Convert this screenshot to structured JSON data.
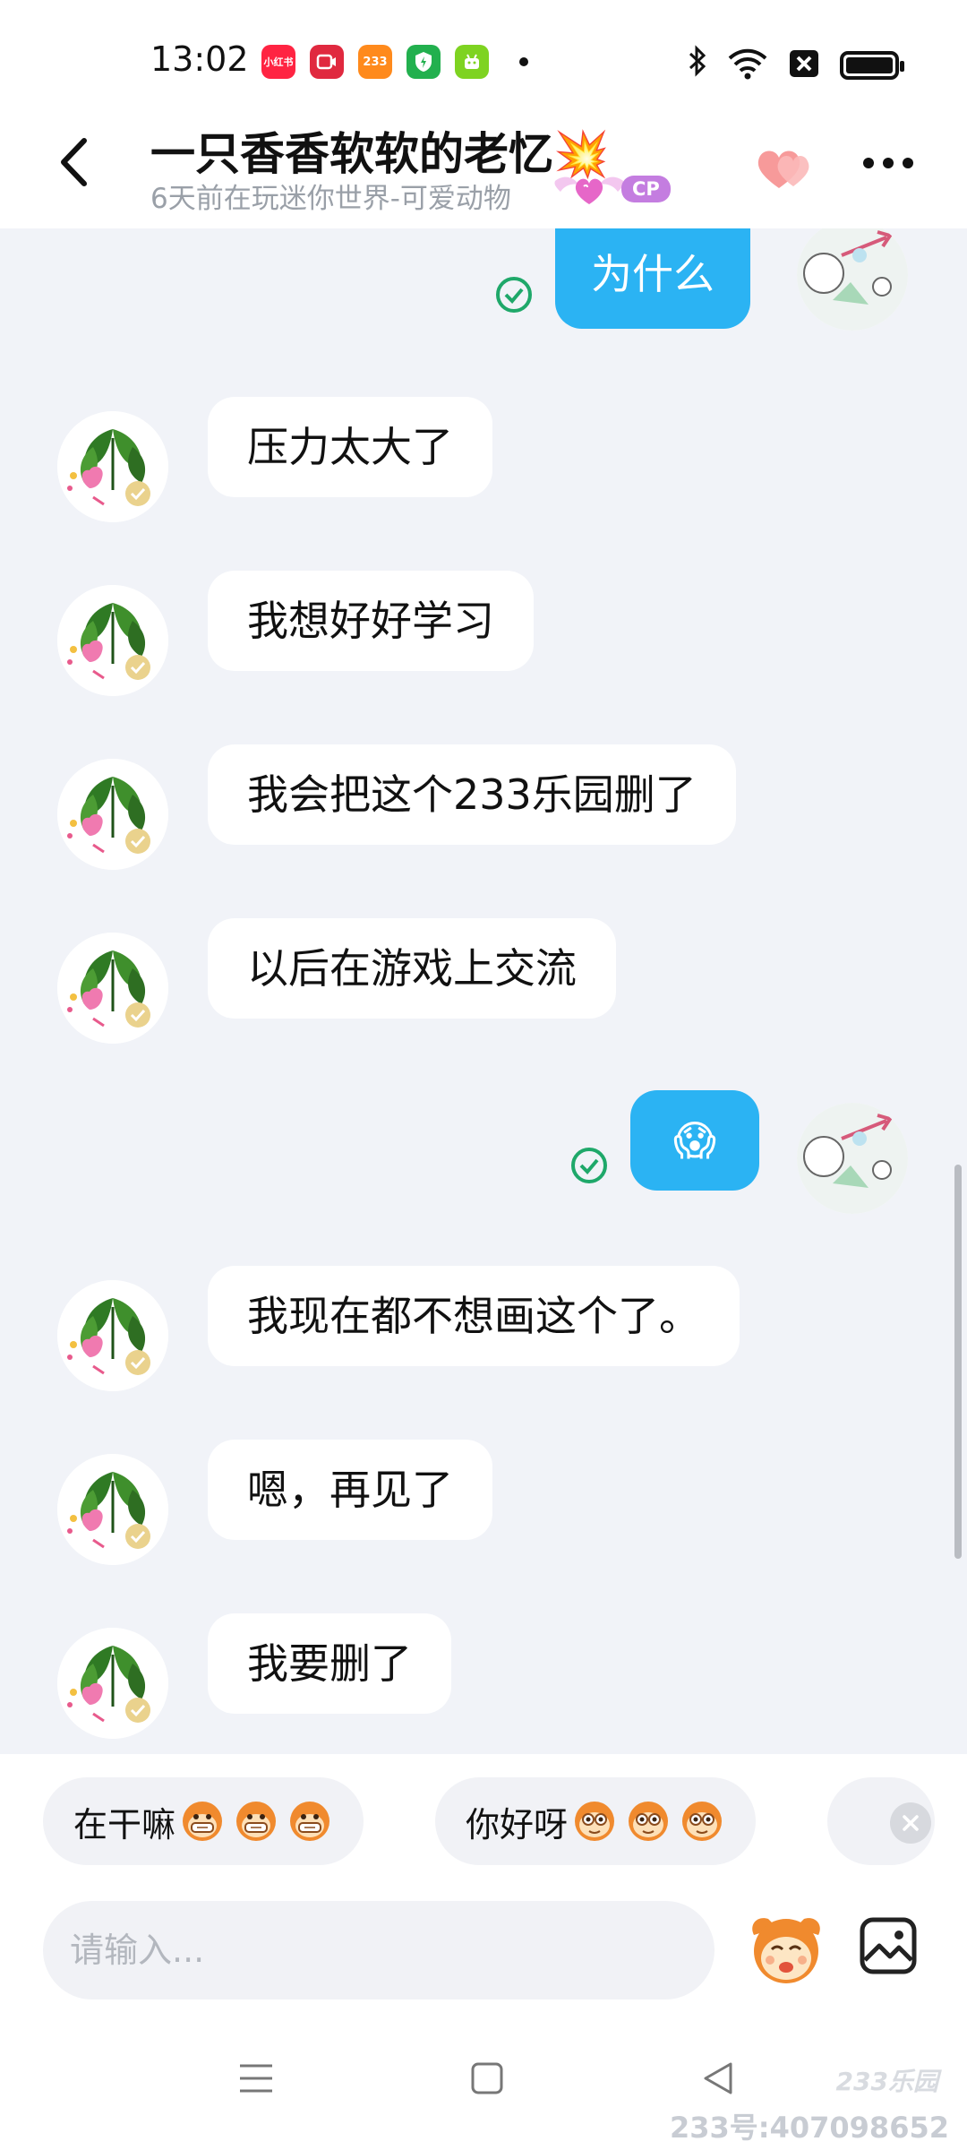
{
  "status_bar": {
    "time": "13:02",
    "apps": [
      {
        "name": "xiaohongshu-app-icon",
        "label": "小红书",
        "color": "#ff2442"
      },
      {
        "name": "video-app-icon",
        "label": "",
        "color": "#e0293f"
      },
      {
        "name": "233-app-icon",
        "label": "233",
        "color": "#ff8a1c"
      },
      {
        "name": "shield-app-icon",
        "label": "",
        "color": "#22b04e"
      },
      {
        "name": "android-app-icon",
        "label": "",
        "color": "#7ed321"
      }
    ]
  },
  "header": {
    "title": "一只香香软软的老忆💥",
    "subtitle": "6天前在玩迷你世界-可爱动物",
    "cp_badge": "CP"
  },
  "messages": [
    {
      "side": "out",
      "text": "为什么"
    },
    {
      "side": "in",
      "text": "压力太大了"
    },
    {
      "side": "in",
      "text": "我想好好学习"
    },
    {
      "side": "in",
      "text": "我会把这个233乐园删了"
    },
    {
      "side": "in",
      "text": "以后在游戏上交流"
    },
    {
      "side": "out",
      "text": "😱"
    },
    {
      "side": "in",
      "text": "我现在都不想画这个了。"
    },
    {
      "side": "in",
      "text": "嗯，再见了"
    },
    {
      "side": "in",
      "text": "我要删了"
    }
  ],
  "quick_replies": [
    {
      "text": "在干嘛"
    },
    {
      "text": "你好呀"
    }
  ],
  "input": {
    "placeholder": "请输入..."
  },
  "watermark": {
    "logo": "233乐园",
    "id_text": "233号:407098652"
  },
  "colors": {
    "bubble_out": "#2bb3f3",
    "bubble_in": "#ffffff",
    "chat_bg": "#f1f3f8",
    "read_check": "#1fa86a"
  }
}
